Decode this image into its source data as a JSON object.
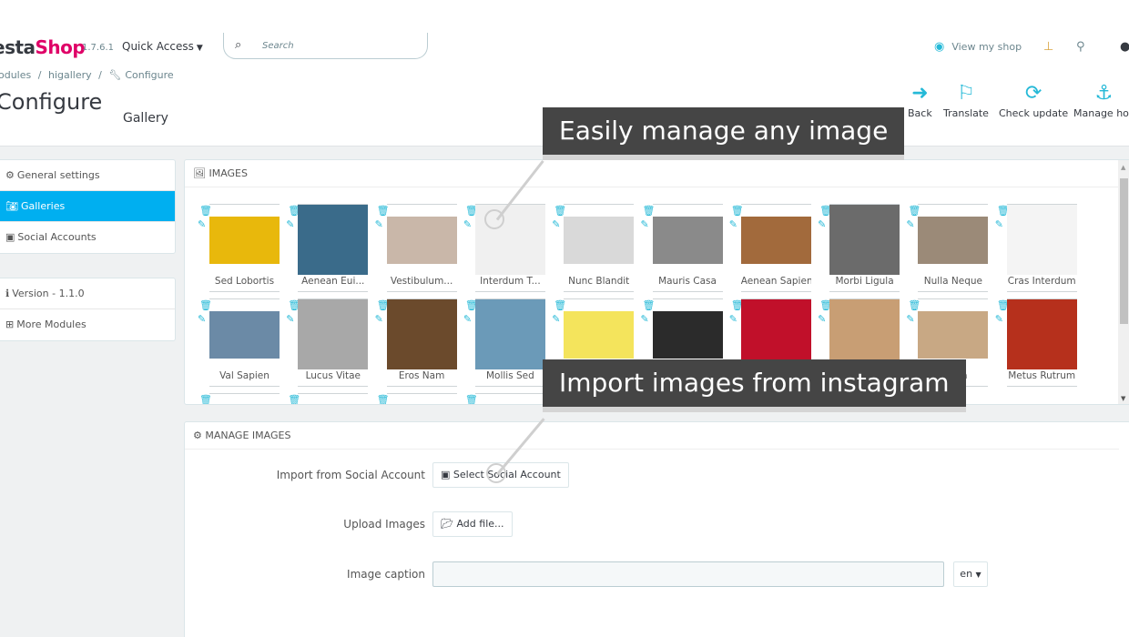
{
  "header": {
    "logo_prefix": "esta",
    "logo_suffix": "Shop",
    "version": "1.7.6.1",
    "quick_access": "Quick Access",
    "search_placeholder": "Search",
    "view_shop": "View my shop"
  },
  "breadcrumb": [
    "odules",
    "/",
    "higallery",
    "/",
    "Configure"
  ],
  "page": {
    "title": "Configure",
    "subtitle": "Gallery"
  },
  "toolbar": [
    {
      "label": "Back",
      "icon": "arrow-left-circle-icon"
    },
    {
      "label": "Translate",
      "icon": "flag-icon"
    },
    {
      "label": "Check update",
      "icon": "refresh-icon"
    },
    {
      "label": "Manage hoc",
      "icon": "anchor-icon"
    }
  ],
  "sidebar": {
    "items": [
      {
        "label": "General settings",
        "icon": "gear-icon",
        "active": false
      },
      {
        "label": "Galleries",
        "icon": "camera-icon",
        "active": true
      },
      {
        "label": "Social Accounts",
        "icon": "instagram-icon",
        "active": false
      }
    ],
    "info": [
      {
        "label": "Version - 1.1.0",
        "icon": "info-icon"
      },
      {
        "label": "More Modules",
        "icon": "plus-square-icon"
      }
    ]
  },
  "images_panel": {
    "title": "IMAGES",
    "images": [
      {
        "caption": "Sed Lobortis",
        "color": "#e8b80c"
      },
      {
        "caption": "Aenean Eui...",
        "color": "#3a6b8a"
      },
      {
        "caption": "Vestibulum...",
        "color": "#c9b7a9"
      },
      {
        "caption": "Interdum T...",
        "color": "#f0f0f0"
      },
      {
        "caption": "Nunc Blandit",
        "color": "#d9d9d9"
      },
      {
        "caption": "Mauris Casa",
        "color": "#8a8a8a"
      },
      {
        "caption": "Aenean Sapien",
        "color": "#a26a3c"
      },
      {
        "caption": "Morbi Ligula",
        "color": "#6b6b6b"
      },
      {
        "caption": "Nulla Neque",
        "color": "#9b8a78"
      },
      {
        "caption": "Cras Interdum",
        "color": "#f4f4f4"
      },
      {
        "caption": "Val Sapien",
        "color": "#6b8aa6"
      },
      {
        "caption": "Lucus Vitae",
        "color": "#a8a8a8"
      },
      {
        "caption": "Eros Nam",
        "color": "#6b4a2c"
      },
      {
        "caption": "Mollis Sed",
        "color": "#6b9ab8"
      },
      {
        "caption": "",
        "color": "#f4e45c"
      },
      {
        "caption": "",
        "color": "#2b2b2b"
      },
      {
        "caption": "",
        "color": "#c1102a"
      },
      {
        "caption": "",
        "color": "#c89e74"
      },
      {
        "caption": "...erra",
        "color": "#c8a884"
      },
      {
        "caption": "Metus Rutrum",
        "color": "#b6301c"
      },
      {
        "caption": "",
        "color": "#e9a8c0"
      },
      {
        "caption": "",
        "color": "#3a4a52"
      },
      {
        "caption": "",
        "color": "#a84a9a"
      },
      {
        "caption": "",
        "color": "#f4f4f4"
      }
    ]
  },
  "manage_panel": {
    "title": "MANAGE IMAGES",
    "import_label": "Import from Social Account",
    "import_button": "Select Social Account",
    "upload_label": "Upload Images",
    "upload_button": "Add file...",
    "caption_label": "Image caption",
    "caption_value": "",
    "lang": "en"
  },
  "callouts": {
    "top": "Easily manage any image",
    "bottom": "Import images from instagram"
  },
  "colors": {
    "accent": "#25b9d7",
    "active": "#00aff0",
    "brand_pink": "#df0067",
    "callout_bg": "#454545"
  }
}
